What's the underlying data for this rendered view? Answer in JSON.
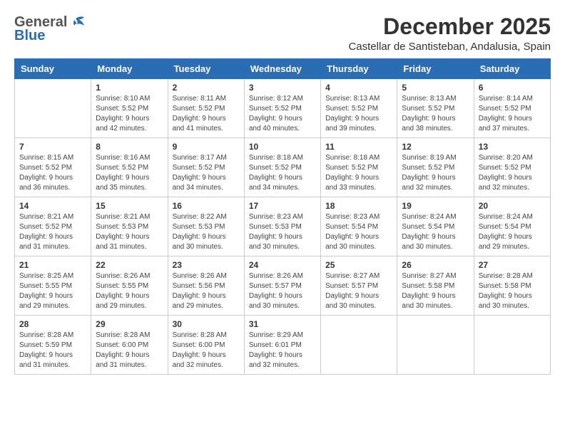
{
  "header": {
    "logo_general": "General",
    "logo_blue": "Blue",
    "month_title": "December 2025",
    "location": "Castellar de Santisteban, Andalusia, Spain"
  },
  "weekdays": [
    "Sunday",
    "Monday",
    "Tuesday",
    "Wednesday",
    "Thursday",
    "Friday",
    "Saturday"
  ],
  "weeks": [
    [
      {
        "day": "",
        "info": ""
      },
      {
        "day": "1",
        "info": "Sunrise: 8:10 AM\nSunset: 5:52 PM\nDaylight: 9 hours\nand 42 minutes."
      },
      {
        "day": "2",
        "info": "Sunrise: 8:11 AM\nSunset: 5:52 PM\nDaylight: 9 hours\nand 41 minutes."
      },
      {
        "day": "3",
        "info": "Sunrise: 8:12 AM\nSunset: 5:52 PM\nDaylight: 9 hours\nand 40 minutes."
      },
      {
        "day": "4",
        "info": "Sunrise: 8:13 AM\nSunset: 5:52 PM\nDaylight: 9 hours\nand 39 minutes."
      },
      {
        "day": "5",
        "info": "Sunrise: 8:13 AM\nSunset: 5:52 PM\nDaylight: 9 hours\nand 38 minutes."
      },
      {
        "day": "6",
        "info": "Sunrise: 8:14 AM\nSunset: 5:52 PM\nDaylight: 9 hours\nand 37 minutes."
      }
    ],
    [
      {
        "day": "7",
        "info": "Sunrise: 8:15 AM\nSunset: 5:52 PM\nDaylight: 9 hours\nand 36 minutes."
      },
      {
        "day": "8",
        "info": "Sunrise: 8:16 AM\nSunset: 5:52 PM\nDaylight: 9 hours\nand 35 minutes."
      },
      {
        "day": "9",
        "info": "Sunrise: 8:17 AM\nSunset: 5:52 PM\nDaylight: 9 hours\nand 34 minutes."
      },
      {
        "day": "10",
        "info": "Sunrise: 8:18 AM\nSunset: 5:52 PM\nDaylight: 9 hours\nand 34 minutes."
      },
      {
        "day": "11",
        "info": "Sunrise: 8:18 AM\nSunset: 5:52 PM\nDaylight: 9 hours\nand 33 minutes."
      },
      {
        "day": "12",
        "info": "Sunrise: 8:19 AM\nSunset: 5:52 PM\nDaylight: 9 hours\nand 32 minutes."
      },
      {
        "day": "13",
        "info": "Sunrise: 8:20 AM\nSunset: 5:52 PM\nDaylight: 9 hours\nand 32 minutes."
      }
    ],
    [
      {
        "day": "14",
        "info": "Sunrise: 8:21 AM\nSunset: 5:52 PM\nDaylight: 9 hours\nand 31 minutes."
      },
      {
        "day": "15",
        "info": "Sunrise: 8:21 AM\nSunset: 5:53 PM\nDaylight: 9 hours\nand 31 minutes."
      },
      {
        "day": "16",
        "info": "Sunrise: 8:22 AM\nSunset: 5:53 PM\nDaylight: 9 hours\nand 30 minutes."
      },
      {
        "day": "17",
        "info": "Sunrise: 8:23 AM\nSunset: 5:53 PM\nDaylight: 9 hours\nand 30 minutes."
      },
      {
        "day": "18",
        "info": "Sunrise: 8:23 AM\nSunset: 5:54 PM\nDaylight: 9 hours\nand 30 minutes."
      },
      {
        "day": "19",
        "info": "Sunrise: 8:24 AM\nSunset: 5:54 PM\nDaylight: 9 hours\nand 30 minutes."
      },
      {
        "day": "20",
        "info": "Sunrise: 8:24 AM\nSunset: 5:54 PM\nDaylight: 9 hours\nand 29 minutes."
      }
    ],
    [
      {
        "day": "21",
        "info": "Sunrise: 8:25 AM\nSunset: 5:55 PM\nDaylight: 9 hours\nand 29 minutes."
      },
      {
        "day": "22",
        "info": "Sunrise: 8:26 AM\nSunset: 5:55 PM\nDaylight: 9 hours\nand 29 minutes."
      },
      {
        "day": "23",
        "info": "Sunrise: 8:26 AM\nSunset: 5:56 PM\nDaylight: 9 hours\nand 29 minutes."
      },
      {
        "day": "24",
        "info": "Sunrise: 8:26 AM\nSunset: 5:57 PM\nDaylight: 9 hours\nand 30 minutes."
      },
      {
        "day": "25",
        "info": "Sunrise: 8:27 AM\nSunset: 5:57 PM\nDaylight: 9 hours\nand 30 minutes."
      },
      {
        "day": "26",
        "info": "Sunrise: 8:27 AM\nSunset: 5:58 PM\nDaylight: 9 hours\nand 30 minutes."
      },
      {
        "day": "27",
        "info": "Sunrise: 8:28 AM\nSunset: 5:58 PM\nDaylight: 9 hours\nand 30 minutes."
      }
    ],
    [
      {
        "day": "28",
        "info": "Sunrise: 8:28 AM\nSunset: 5:59 PM\nDaylight: 9 hours\nand 31 minutes."
      },
      {
        "day": "29",
        "info": "Sunrise: 8:28 AM\nSunset: 6:00 PM\nDaylight: 9 hours\nand 31 minutes."
      },
      {
        "day": "30",
        "info": "Sunrise: 8:28 AM\nSunset: 6:00 PM\nDaylight: 9 hours\nand 32 minutes."
      },
      {
        "day": "31",
        "info": "Sunrise: 8:29 AM\nSunset: 6:01 PM\nDaylight: 9 hours\nand 32 minutes."
      },
      {
        "day": "",
        "info": ""
      },
      {
        "day": "",
        "info": ""
      },
      {
        "day": "",
        "info": ""
      }
    ]
  ]
}
